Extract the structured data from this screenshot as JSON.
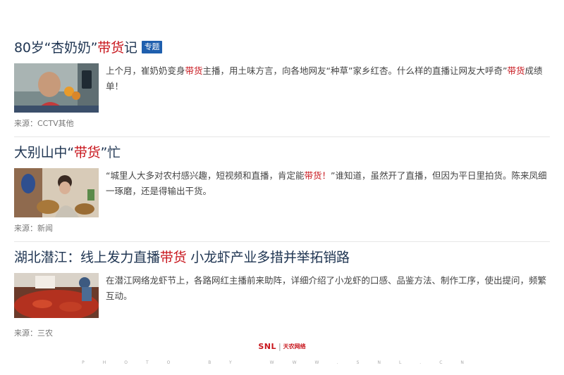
{
  "articles": [
    {
      "title_pre": "80岁“杏奶奶”",
      "title_hl": "带货",
      "title_post": "记",
      "tag": "专题",
      "summary_pre": "上个月，崔奶奶变身",
      "summary_hl": "带货",
      "summary_mid": "主播，用土味方言，向各地网友“种草”家乡红杏。什么样的直播让网友大呼奇”",
      "summary_hl2": "带货",
      "summary_post": "成绩单！",
      "source": "来源：CCTV其他"
    },
    {
      "title_pre": "大别山中“",
      "title_hl": "带货",
      "title_post": "”忙",
      "summary_pre": "“城里人大多对农村感兴趣，短视频和直播，肯定能",
      "summary_hl": "带货！",
      "summary_post": "”谁知道，虽然开了直播，但因为平日里拍货。陈来凤细一琢磨，还是得输出干货。",
      "source": "来源：新闻"
    },
    {
      "title_pre": "湖北潜江：线上发力直播",
      "title_hl": "带货",
      "title_post": " 小龙虾产业多措并举拓销路",
      "summary": "在潜江网络龙虾节上，各路网红主播前来助阵，详细介绍了小龙虾的口感、品鉴方法、制作工序，使出提问，频繁互动。",
      "source": "来源：三农"
    }
  ],
  "footer": {
    "logo_mark": "SNL",
    "logo_sep": "|",
    "logo_cn": "天农网络",
    "credit": "PHOTO BY WWW.SNL.CN"
  },
  "colors": {
    "title": "#1f3552",
    "highlight": "#c8161d",
    "tag_bg": "#1f5fae"
  }
}
